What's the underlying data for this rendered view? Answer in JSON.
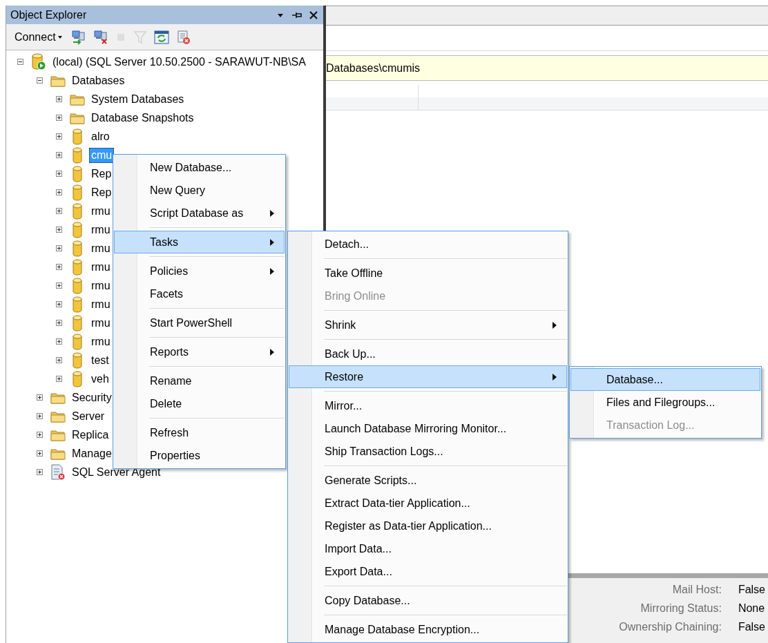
{
  "object_explorer": {
    "title": "Object Explorer",
    "toolbar": {
      "connect_label": "Connect",
      "buttons": [
        {
          "kind": "connect",
          "disabled": false
        },
        {
          "kind": "disconnect",
          "disabled": false
        },
        {
          "kind": "stop",
          "disabled": true
        },
        {
          "kind": "filter",
          "disabled": true
        },
        {
          "kind": "refresh",
          "disabled": false
        },
        {
          "kind": "script-stop",
          "disabled": false
        }
      ]
    },
    "tree": [
      {
        "label": "(local) (SQL Server 10.50.2500 - SARAWUT-NB\\SA",
        "kind": "server",
        "expanded": true,
        "selected": false,
        "children": [
          {
            "label": "Databases",
            "kind": "folder",
            "expanded": true,
            "selected": false,
            "children": [
              {
                "label": "System Databases",
                "kind": "folder",
                "expanded": false,
                "selected": false
              },
              {
                "label": "Database Snapshots",
                "kind": "folder",
                "expanded": false,
                "selected": false
              },
              {
                "label": "alro",
                "kind": "database",
                "expanded": false,
                "selected": false
              },
              {
                "label": "cmu",
                "kind": "database",
                "expanded": false,
                "selected": true
              },
              {
                "label": "Rep",
                "kind": "database",
                "expanded": false,
                "selected": false
              },
              {
                "label": "Rep",
                "kind": "database",
                "expanded": false,
                "selected": false
              },
              {
                "label": "rmu",
                "kind": "database",
                "expanded": false,
                "selected": false
              },
              {
                "label": "rmu",
                "kind": "database",
                "expanded": false,
                "selected": false
              },
              {
                "label": "rmu",
                "kind": "database",
                "expanded": false,
                "selected": false
              },
              {
                "label": "rmu",
                "kind": "database",
                "expanded": false,
                "selected": false
              },
              {
                "label": "rmu",
                "kind": "database",
                "expanded": false,
                "selected": false
              },
              {
                "label": "rmu",
                "kind": "database",
                "expanded": false,
                "selected": false
              },
              {
                "label": "rmu",
                "kind": "database",
                "expanded": false,
                "selected": false
              },
              {
                "label": "rmu",
                "kind": "database",
                "expanded": false,
                "selected": false
              },
              {
                "label": "test",
                "kind": "database",
                "expanded": false,
                "selected": false
              },
              {
                "label": "veh",
                "kind": "database",
                "expanded": false,
                "selected": false
              }
            ]
          },
          {
            "label": "Security",
            "kind": "folder",
            "expanded": false,
            "selected": false
          },
          {
            "label": "Server",
            "kind": "folder",
            "expanded": false,
            "selected": false
          },
          {
            "label": "Replica",
            "kind": "folder",
            "expanded": false,
            "selected": false
          },
          {
            "label": "Manage",
            "kind": "folder",
            "expanded": false,
            "selected": false
          },
          {
            "label": "SQL Server Agent",
            "kind": "agent",
            "expanded": false,
            "selected": false
          }
        ]
      }
    ]
  },
  "details": {
    "path": "Databases\\cmumis",
    "properties": [
      {
        "label": "Mail Host:",
        "value": "False"
      },
      {
        "label": "Mirroring Status:",
        "value": "None"
      },
      {
        "label": "Ownership Chaining:",
        "value": "False"
      }
    ]
  },
  "context_menus": [
    {
      "items": [
        {
          "kind": "item",
          "label": "New Database...",
          "submenu": false,
          "selected": false,
          "disabled": false
        },
        {
          "kind": "item",
          "label": "New Query",
          "submenu": false,
          "selected": false,
          "disabled": false
        },
        {
          "kind": "item",
          "label": "Script Database as",
          "submenu": true,
          "selected": false,
          "disabled": false
        },
        {
          "kind": "separator"
        },
        {
          "kind": "item",
          "label": "Tasks",
          "submenu": true,
          "selected": true,
          "disabled": false
        },
        {
          "kind": "separator"
        },
        {
          "kind": "item",
          "label": "Policies",
          "submenu": true,
          "selected": false,
          "disabled": false
        },
        {
          "kind": "item",
          "label": "Facets",
          "submenu": false,
          "selected": false,
          "disabled": false
        },
        {
          "kind": "separator"
        },
        {
          "kind": "item",
          "label": "Start PowerShell",
          "submenu": false,
          "selected": false,
          "disabled": false
        },
        {
          "kind": "separator"
        },
        {
          "kind": "item",
          "label": "Reports",
          "submenu": true,
          "selected": false,
          "disabled": false
        },
        {
          "kind": "separator"
        },
        {
          "kind": "item",
          "label": "Rename",
          "submenu": false,
          "selected": false,
          "disabled": false
        },
        {
          "kind": "item",
          "label": "Delete",
          "submenu": false,
          "selected": false,
          "disabled": false
        },
        {
          "kind": "separator"
        },
        {
          "kind": "item",
          "label": "Refresh",
          "submenu": false,
          "selected": false,
          "disabled": false
        },
        {
          "kind": "item",
          "label": "Properties",
          "submenu": false,
          "selected": false,
          "disabled": false
        }
      ]
    },
    {
      "items": [
        {
          "kind": "item",
          "label": "Detach...",
          "submenu": false,
          "selected": false,
          "disabled": false
        },
        {
          "kind": "separator"
        },
        {
          "kind": "item",
          "label": "Take Offline",
          "submenu": false,
          "selected": false,
          "disabled": false
        },
        {
          "kind": "item",
          "label": "Bring Online",
          "submenu": false,
          "selected": false,
          "disabled": true
        },
        {
          "kind": "separator"
        },
        {
          "kind": "item",
          "label": "Shrink",
          "submenu": true,
          "selected": false,
          "disabled": false
        },
        {
          "kind": "separator"
        },
        {
          "kind": "item",
          "label": "Back Up...",
          "submenu": false,
          "selected": false,
          "disabled": false
        },
        {
          "kind": "item",
          "label": "Restore",
          "submenu": true,
          "selected": true,
          "disabled": false
        },
        {
          "kind": "separator"
        },
        {
          "kind": "item",
          "label": "Mirror...",
          "submenu": false,
          "selected": false,
          "disabled": false
        },
        {
          "kind": "item",
          "label": "Launch Database Mirroring Monitor...",
          "submenu": false,
          "selected": false,
          "disabled": false
        },
        {
          "kind": "item",
          "label": "Ship Transaction Logs...",
          "submenu": false,
          "selected": false,
          "disabled": false
        },
        {
          "kind": "separator"
        },
        {
          "kind": "item",
          "label": "Generate Scripts...",
          "submenu": false,
          "selected": false,
          "disabled": false
        },
        {
          "kind": "item",
          "label": "Extract Data-tier Application...",
          "submenu": false,
          "selected": false,
          "disabled": false
        },
        {
          "kind": "item",
          "label": "Register as Data-tier Application...",
          "submenu": false,
          "selected": false,
          "disabled": false
        },
        {
          "kind": "item",
          "label": "Import Data...",
          "submenu": false,
          "selected": false,
          "disabled": false
        },
        {
          "kind": "item",
          "label": "Export Data...",
          "submenu": false,
          "selected": false,
          "disabled": false
        },
        {
          "kind": "separator"
        },
        {
          "kind": "item",
          "label": "Copy Database...",
          "submenu": false,
          "selected": false,
          "disabled": false
        },
        {
          "kind": "separator"
        },
        {
          "kind": "item",
          "label": "Manage Database Encryption...",
          "submenu": false,
          "selected": false,
          "disabled": false
        }
      ]
    },
    {
      "items": [
        {
          "kind": "item",
          "label": "Database...",
          "submenu": false,
          "selected": true,
          "disabled": false
        },
        {
          "kind": "item",
          "label": "Files and Filegroups...",
          "submenu": false,
          "selected": false,
          "disabled": false
        },
        {
          "kind": "item",
          "label": "Transaction Log...",
          "submenu": false,
          "selected": false,
          "disabled": true
        }
      ]
    }
  ]
}
